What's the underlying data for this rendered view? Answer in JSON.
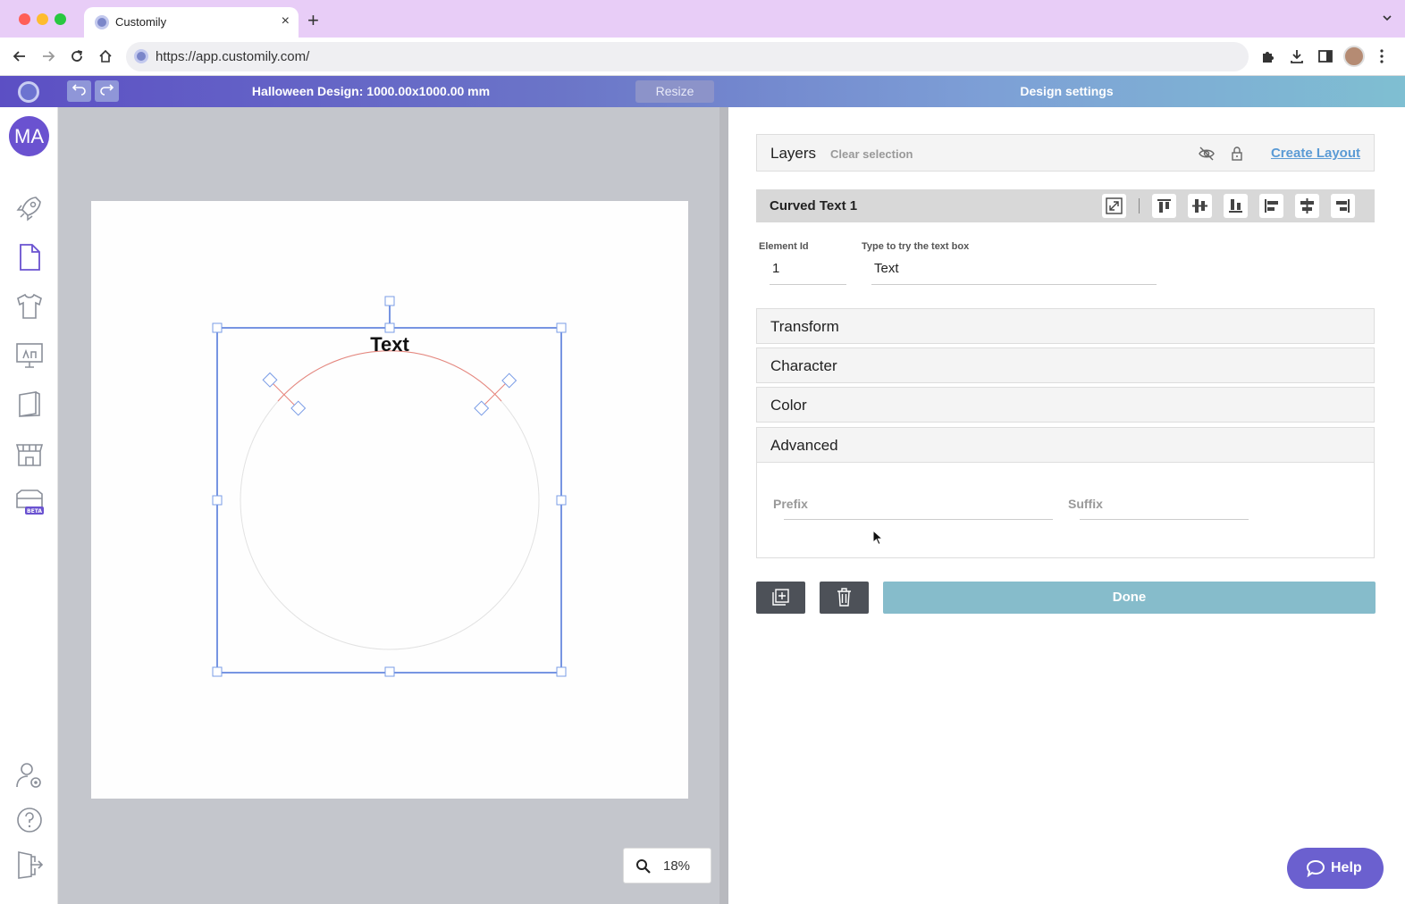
{
  "browser": {
    "tab_title": "Customily",
    "tab_close": "×",
    "new_tab": "+",
    "url": "https://app.customily.com/"
  },
  "app_header": {
    "design_title": "Halloween Design: 1000.00x1000.00 mm",
    "resize_label": "Resize",
    "settings_title": "Design settings"
  },
  "sidebar": {
    "avatar_initials": "MA",
    "items": [
      "rocket-icon",
      "document-icon",
      "tshirt-icon",
      "monitor-icon",
      "book-icon",
      "store-icon",
      "store-beta-icon"
    ],
    "bottom_items": [
      "user-settings-icon",
      "help-icon",
      "logout-icon"
    ],
    "beta_badge": "BETA"
  },
  "canvas": {
    "curved_text": "Text",
    "zoom_level": "18%",
    "selection_color": "#4a72d9",
    "path_color": "#e8837a"
  },
  "panel": {
    "layers_label": "Layers",
    "clear_selection": "Clear selection",
    "create_layout": "Create Layout",
    "element_title": "Curved Text 1",
    "element_id_label": "Element Id",
    "element_id_value": "1",
    "text_label": "Type to try the text box",
    "text_value": "Text",
    "sections": [
      "Transform",
      "Character",
      "Color",
      "Advanced"
    ],
    "prefix_placeholder": "Prefix",
    "suffix_placeholder": "Suffix",
    "done_label": "Done"
  },
  "help": {
    "label": "Help"
  },
  "colors": {
    "header_gradient_start": "#5c4fc4",
    "header_gradient_end": "#7fbfd2",
    "done_button": "#86bccb",
    "help_button": "#6b60cf",
    "dark_button": "#4d5158"
  }
}
